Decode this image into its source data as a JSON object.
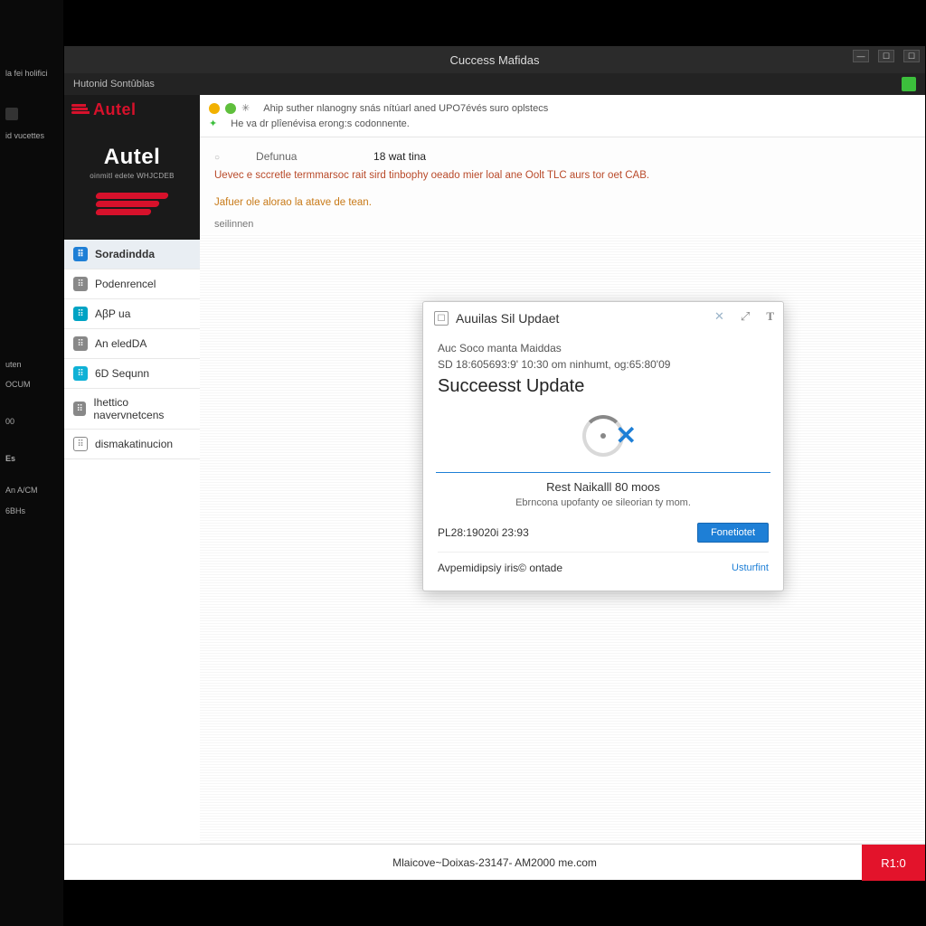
{
  "os_strip": {
    "items": [
      "la fei holifici",
      "id vucettes",
      "uten",
      "OCUM",
      "00",
      "Es",
      "An A/CM",
      "6BHs"
    ]
  },
  "window": {
    "title": "Cuccess Mafidas",
    "subheader": "Hutonid Sontûblas"
  },
  "brand": {
    "name": "Autel",
    "hero_title": "Autel",
    "hero_sub": "oinmitl edete WHJCDEB"
  },
  "nav": {
    "items": [
      {
        "label": "Soradindda",
        "icon": "chat-icon",
        "cls": "ic-blue",
        "active": true
      },
      {
        "label": "Podenrencel",
        "icon": "doc-icon",
        "cls": "ic-grey",
        "active": false
      },
      {
        "label": "AβP ua",
        "icon": "gear-icon",
        "cls": "ic-teal",
        "active": false
      },
      {
        "label": "An eledDA",
        "icon": "list-icon",
        "cls": "ic-grey",
        "active": false
      },
      {
        "label": "6D Sequnn",
        "icon": "card-icon",
        "cls": "ic-cyan",
        "active": false
      },
      {
        "label": "Ihettico navervnetcens",
        "icon": "page-icon",
        "cls": "ic-grey",
        "active": false
      },
      {
        "label": "dismakatinucion",
        "icon": "search-icon",
        "cls": "ic-outline",
        "active": false
      }
    ]
  },
  "notice": {
    "line1": "Ahip suther nlanogny snás nítúarl aned UPO7évés suro oplstecs",
    "line2": "He va dr plîenévisa erong:s codonnente."
  },
  "meta": {
    "label": "Defunua",
    "value": "18 wat tina"
  },
  "warnings": {
    "w1": "Uevec e sccretle termmarsoc rait sird tinbophy oeado mier loal ane Oolt TLC aurs tor oet CAB.",
    "w2": "Jafuer ole alorao la atave de tean."
  },
  "small_label": "seilinnen",
  "modal": {
    "title": "Auuilas Sil Updaet",
    "line1": "Auc Soco manta Maiddas",
    "line2": "SD 18:605693:9' 10:30 om ninhumt, og:65:80'09",
    "headline": "Succeesst Update",
    "rest_line": "Rest Naikalll 80 moos",
    "sub_line": "Ebrncona upofanty oe sileorian ty mom.",
    "code": "PL28:19020i 23:93",
    "button": "Fonetiotet",
    "footer_left": "Avpemidipsiy iris© ontade",
    "footer_link": "Usturfint"
  },
  "footer": {
    "text": "Mlaicove~Doixas-23147- AM2000 me.com",
    "button": "R1:0"
  }
}
